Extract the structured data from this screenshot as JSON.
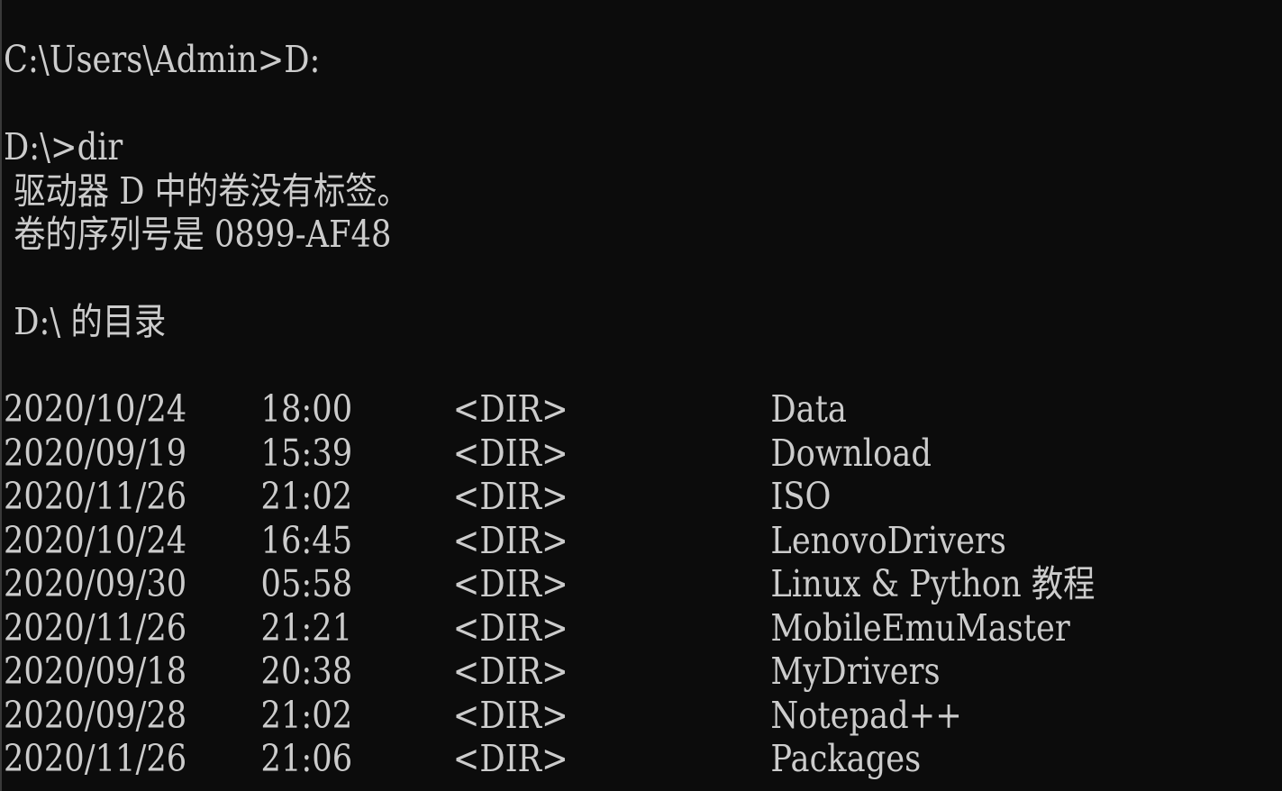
{
  "window": {
    "type": "command-prompt",
    "background_color": "#0c0c0c",
    "text_color": "#cccccc"
  },
  "session": {
    "line1": "C:\\Users\\Admin>D:",
    "line2": "D:\\>dir",
    "volume_label": " 驱动器 D 中的卷没有标签。",
    "serial_number": " 卷的序列号是 0899-AF48",
    "directory_header": " D:\\ 的目录"
  },
  "listing": [
    {
      "date": "2020/10/24",
      "time": "18:00",
      "type": "<DIR>",
      "name": "Data"
    },
    {
      "date": "2020/09/19",
      "time": "15:39",
      "type": "<DIR>",
      "name": "Download"
    },
    {
      "date": "2020/11/26",
      "time": "21:02",
      "type": "<DIR>",
      "name": "ISO"
    },
    {
      "date": "2020/10/24",
      "time": "16:45",
      "type": "<DIR>",
      "name": "LenovoDrivers"
    },
    {
      "date": "2020/09/30",
      "time": "05:58",
      "type": "<DIR>",
      "name": "Linux & Python 教程"
    },
    {
      "date": "2020/11/26",
      "time": "21:21",
      "type": "<DIR>",
      "name": "MobileEmuMaster"
    },
    {
      "date": "2020/09/18",
      "time": "20:38",
      "type": "<DIR>",
      "name": "MyDrivers"
    },
    {
      "date": "2020/09/28",
      "time": "21:02",
      "type": "<DIR>",
      "name": "Notepad++"
    },
    {
      "date": "2020/11/26",
      "time": "21:06",
      "type": "<DIR>",
      "name": "Packages"
    }
  ]
}
